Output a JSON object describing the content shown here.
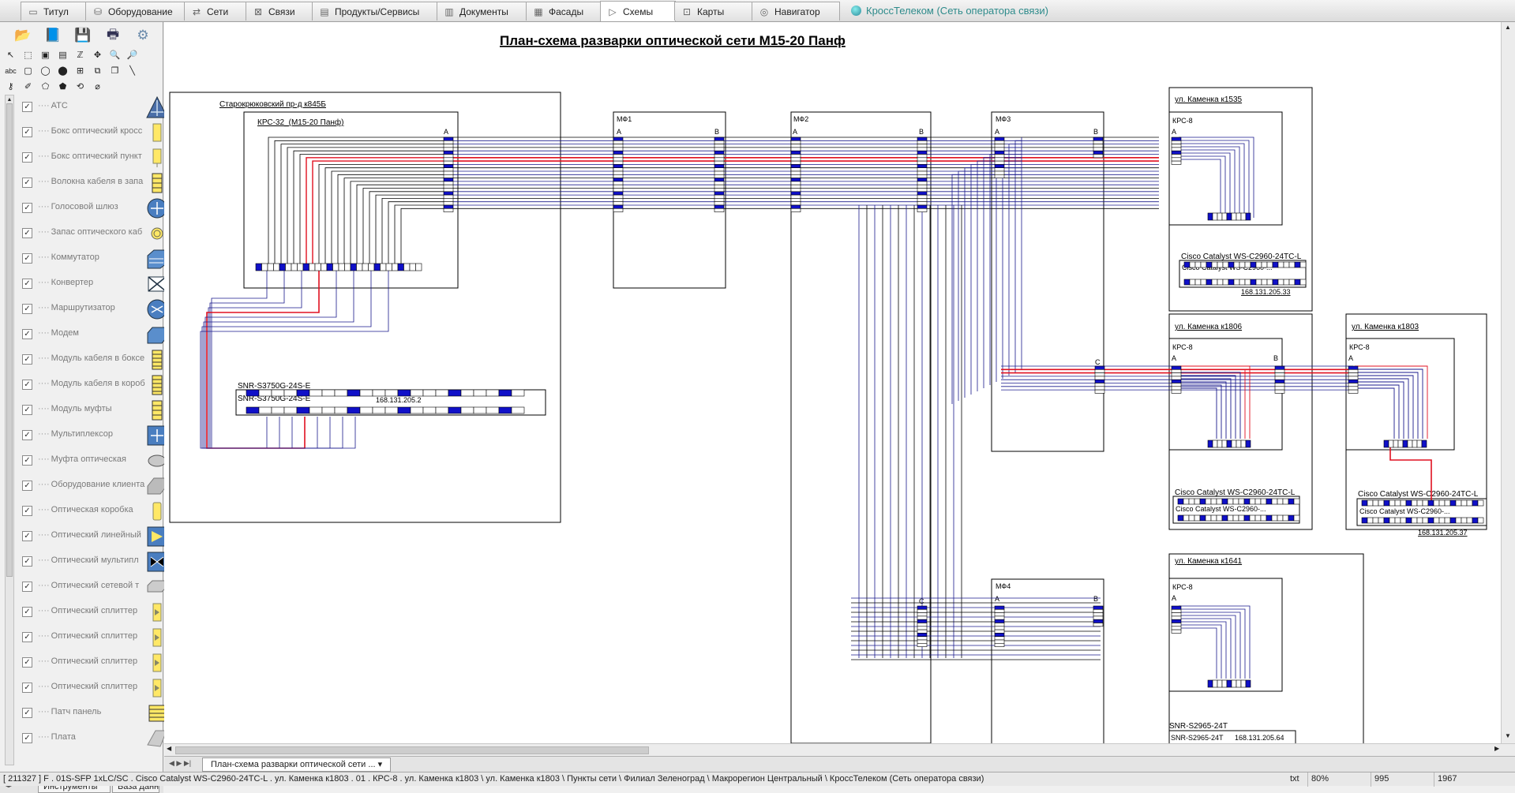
{
  "tabs": [
    {
      "label": "Титул",
      "icon": "title-icon"
    },
    {
      "label": "Оборудование",
      "icon": "database-icon"
    },
    {
      "label": "Сети",
      "icon": "network-icon"
    },
    {
      "label": "Связи",
      "icon": "links-icon"
    },
    {
      "label": "Продукты/Сервисы",
      "icon": "products-icon"
    },
    {
      "label": "Документы",
      "icon": "documents-icon"
    },
    {
      "label": "Фасады",
      "icon": "facades-icon"
    },
    {
      "label": "Схемы",
      "icon": "schemes-icon",
      "active": true
    },
    {
      "label": "Карты",
      "icon": "maps-icon"
    },
    {
      "label": "Навигатор",
      "icon": "navigator-icon"
    }
  ],
  "app_title": "КроссТелеком (Сеть оператора связи)",
  "legend_items": [
    "АТС",
    "Бокс оптический кросс",
    "Бокс оптический пункт",
    "Волокна кабеля в запа",
    "Голосовой шлюз",
    "Запас оптического каб",
    "Коммутатор",
    "Конвертер",
    "Маршрутизатор",
    "Модем",
    "Модуль кабеля в боксе",
    "Модуль кабеля в короб",
    "Модуль муфты",
    "Мультиплексор",
    "Муфта оптическая",
    "Оборудование клиента",
    "Оптическая коробка",
    "Оптический линейный",
    "Оптический мультипл",
    "Оптический сетевой т",
    "Оптический сплиттер",
    "Оптический сплиттер",
    "Оптический сплиттер",
    "Оптический сплиттер",
    "Патч панель",
    "Плата"
  ],
  "left_bottom_tabs": [
    "Инструменты",
    "База данн"
  ],
  "diagram": {
    "title": "План-схема разварки оптической сети М15-20 Панф",
    "building_main": "Старокрюковский пр-д к845Б",
    "krs32": "КРС-32_(М15-20 Панф)",
    "snr_main_1": "SNR-S3750G-24S-E",
    "snr_main_2": "SNR-S3750G-24S-E",
    "snr_main_ip": "168.131.205.2",
    "mf1": "МФ1",
    "mf2": "МФ2",
    "mf3": "МФ3",
    "mf4": "МФ4",
    "port_a": "A",
    "port_b": "B",
    "port_c": "C",
    "k1535": "ул. Каменка к1535",
    "k1806": "ул. Каменка к1806",
    "k1803": "ул. Каменка к1803",
    "k1641": "ул. Каменка к1641",
    "krs8": "КРС-8",
    "cisco_1": "Cisco Catalyst WS-C2960-24TC-L",
    "cisco_2": "Cisco Catalyst WS-C2960-...",
    "ip_33": "168.131.205.33",
    "ip_37": "168.131.205.37",
    "ip_64": "168.131.205.64",
    "snr2965_1": "SNR-S2965-24T",
    "snr2965_2": "SNR-S2965-24T"
  },
  "doc_tab": "План-схема разварки оптической сети ...",
  "status": {
    "path": "[ 211327 ] F . 01S-SFP 1xLC/SC . Cisco Catalyst WS-C2960-24TC-L . ул. Каменка к1803 . 01 . КРС-8 . ул. Каменка к1803 \\ ул. Каменка к1803 \\ Пункты сети \\ Филиал Зеленоград \\ Макрорегион Центральный \\ КроссТелеком (Сеть оператора связи)",
    "mode": "txt",
    "zoom": "80%",
    "x": "995",
    "y": "1967"
  },
  "colors": {
    "fiber": "#1a1a8c",
    "active": "#e01020",
    "port": "#1010c8",
    "text": "#000000"
  }
}
